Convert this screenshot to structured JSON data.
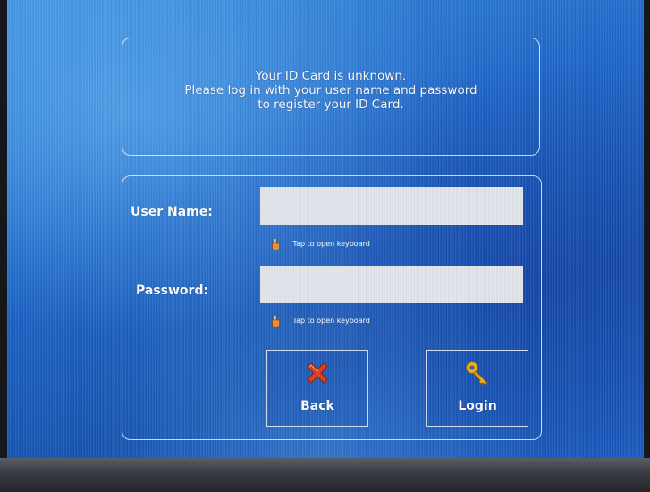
{
  "message": {
    "line1": "Your ID Card is unknown.",
    "line2": "Please log in with your user name and password",
    "line3": "to register your ID Card."
  },
  "form": {
    "username_label": "User Name:",
    "username_value": "",
    "username_hint": "Tap to open keyboard",
    "password_label": "Password:",
    "password_value": "",
    "password_hint": "Tap to open keyboard"
  },
  "buttons": {
    "back_label": "Back",
    "login_label": "Login"
  },
  "icons": {
    "hint": "hand-pointer-icon",
    "back": "red-x-icon",
    "login": "key-icon"
  },
  "colors": {
    "background": "#1d66c8",
    "text": "#ffffff",
    "input_background": "#e2e6ec",
    "back_icon": "#e03a1a",
    "login_icon": "#e8b020"
  }
}
